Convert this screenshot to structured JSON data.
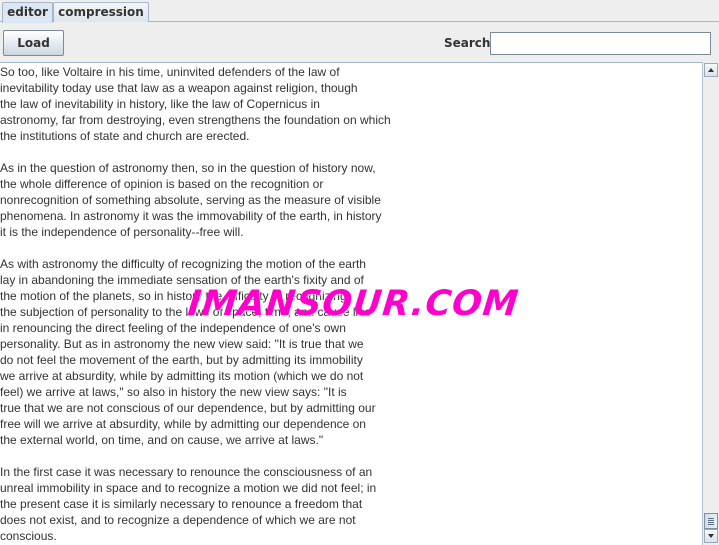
{
  "tabs": {
    "editor": "editor",
    "compression": "compression"
  },
  "toolbar": {
    "load_label": "Load",
    "search_label": "Search",
    "search_value": ""
  },
  "editor": {
    "text": "So too, like Voltaire in his time, uninvited defenders of the law of\ninevitability today use that law as a weapon against religion, though\nthe law of inevitability in history, like the law of Copernicus in\nastronomy, far from destroying, even strengthens the foundation on which\nthe institutions of state and church are erected.\n\nAs in the question of astronomy then, so in the question of history now,\nthe whole difference of opinion is based on the recognition or\nnonrecognition of something absolute, serving as the measure of visible\nphenomena. In astronomy it was the immovability of the earth, in history\nit is the independence of personality--free will.\n\nAs with astronomy the difficulty of recognizing the motion of the earth\nlay in abandoning the immediate sensation of the earth's fixity and of\nthe motion of the planets, so in history the difficulty of recognizing\nthe subjection of personality to the laws of space, time, and cause lies\nin renouncing the direct feeling of the independence of one's own\npersonality. But as in astronomy the new view said: \"It is true that we\ndo not feel the movement of the earth, but by admitting its immobility\nwe arrive at absurdity, while by admitting its motion (which we do not\nfeel) we arrive at laws,\" so also in history the new view says: \"It is\ntrue that we are not conscious of our dependence, but by admitting our\nfree will we arrive at absurdity, while by admitting our dependence on\nthe external world, on time, and on cause, we arrive at laws.\"\n\nIn the first case it was necessary to renounce the consciousness of an\nunreal immobility in space and to recognize a motion we did not feel; in\nthe present case it is similarly necessary to renounce a freedom that\ndoes not exist, and to recognize a dependence of which we are not\nconscious."
  },
  "watermark": {
    "text": "IMANSOUR.COM"
  },
  "scrollbar": {
    "position": 1.0
  }
}
